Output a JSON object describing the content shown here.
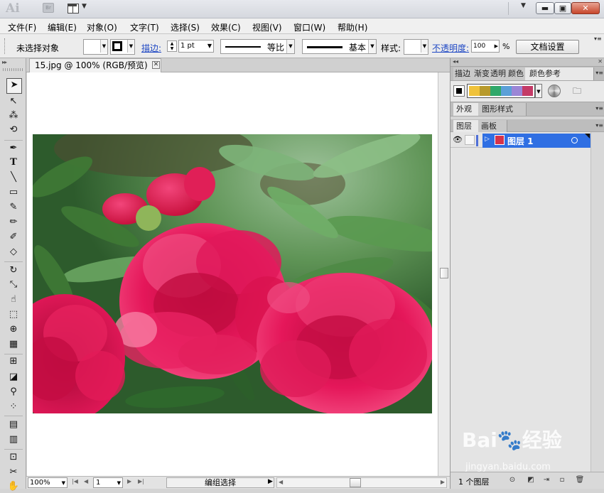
{
  "app": {
    "logo": "Ai",
    "bridge_label": "Br"
  },
  "window": {
    "minimize": "▬",
    "maximize": "▣",
    "close": "✕",
    "workspace_arrow": "▼"
  },
  "menu": [
    "文件(F)",
    "编辑(E)",
    "对象(O)",
    "文字(T)",
    "选择(S)",
    "效果(C)",
    "视图(V)",
    "窗口(W)",
    "帮助(H)"
  ],
  "control": {
    "selection_status": "未选择对象",
    "stroke_link": "描边:",
    "stroke_weight": "1 pt",
    "profile_label": "等比",
    "brush_label": "基本",
    "style_label": "样式:",
    "opacity_link": "不透明度:",
    "opacity_value": "100",
    "percent": "%",
    "doc_setup_button": "文档设置"
  },
  "document": {
    "tab_title": "15.jpg @ 100% (RGB/预览)",
    "tab_close": "✕",
    "zoom": "100%",
    "page": "1",
    "status_text": "编组选择"
  },
  "panels": {
    "tabs_top": [
      "描边",
      "渐变",
      "透明",
      "颜色",
      "颜色参考"
    ],
    "tabs_mid": [
      "外观",
      "图形样式"
    ],
    "tabs_layers": [
      "图层",
      "画板"
    ],
    "harmony_colors": [
      "#f0c23a",
      "#b89a2c",
      "#2fa86a",
      "#5ba0d8",
      "#9b86d6",
      "#c43a66"
    ],
    "layer_name": "图层 1",
    "layer_count": "1 个图层"
  },
  "colors": {
    "accent": "#2f6fe3",
    "link": "#1f48c4",
    "close": "#c7462b"
  },
  "watermark": {
    "brand": "Bai🐾经验",
    "url": "jingyan.baidu.com"
  }
}
